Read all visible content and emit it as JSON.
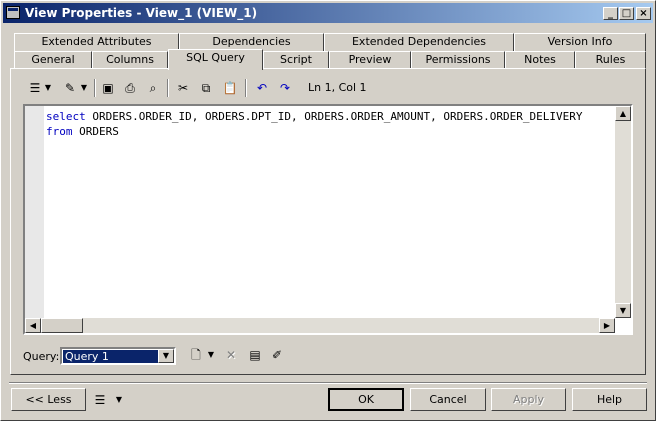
{
  "window": {
    "title": "View Properties - View_1 (VIEW_1)"
  },
  "tabs_row1": [
    "Extended Attributes",
    "Dependencies",
    "Extended Dependencies",
    "Version Info"
  ],
  "tabs_row2": [
    "General",
    "Columns",
    "SQL Query",
    "Script",
    "Preview",
    "Permissions",
    "Notes",
    "Rules"
  ],
  "active_tab": "SQL Query",
  "toolbar": {
    "position": "Ln 1, Col 1"
  },
  "editor": {
    "line1_kw": "select",
    "line1_rest": " ORDERS.ORDER_ID, ORDERS.DPT_ID, ORDERS.ORDER_AMOUNT, ORDERS.ORDER_DELIVERY",
    "line2_kw": "from",
    "line2_rest": " ORDERS"
  },
  "query": {
    "label": "Query:",
    "value": "Query 1"
  },
  "footer": {
    "less": "<< Less",
    "ok": "OK",
    "cancel": "Cancel",
    "apply": "Apply",
    "help": "Help"
  }
}
